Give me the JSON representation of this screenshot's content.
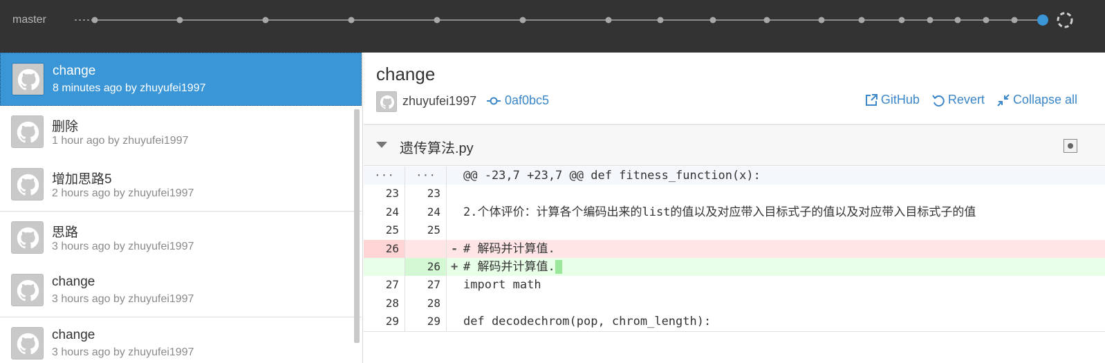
{
  "app": {
    "branch": "master"
  },
  "commits": [
    {
      "title": "change",
      "meta": "8 minutes ago by zhuyufei1997",
      "selected": true
    },
    {
      "title": "删除",
      "meta": "1 hour ago by zhuyufei1997"
    },
    {
      "title": "增加思路5",
      "meta": "2 hours ago by zhuyufei1997"
    },
    {
      "title": "思路",
      "meta": "3 hours ago by zhuyufei1997"
    },
    {
      "title": "change",
      "meta": "3 hours ago by zhuyufei1997"
    },
    {
      "title": "change",
      "meta": "3 hours ago by zhuyufei1997"
    }
  ],
  "detail": {
    "title": "change",
    "author": "zhuyufei1997",
    "sha": "0af0bc5",
    "actions": {
      "github": "GitHub",
      "revert": "Revert",
      "collapse": "Collapse all"
    }
  },
  "file": {
    "name": "遗传算法.py",
    "lines": [
      {
        "type": "hunk",
        "old": "···",
        "new": "···",
        "marker": "",
        "code": "@@ -23,7 +23,7 @@ def fitness_function(x):"
      },
      {
        "type": "ctx",
        "old": "23",
        "new": "23",
        "marker": "",
        "code": ""
      },
      {
        "type": "ctx",
        "old": "24",
        "new": "24",
        "marker": "",
        "code": "2.个体评价：计算各个编码出来的list的值以及对应带入目标式子的值以及对应带入目标式子的值"
      },
      {
        "type": "ctx",
        "old": "25",
        "new": "25",
        "marker": "",
        "code": ""
      },
      {
        "type": "del",
        "old": "26",
        "new": "",
        "marker": "-",
        "code": "# 解码并计算值."
      },
      {
        "type": "add",
        "old": "",
        "new": "26",
        "marker": "+",
        "code": "# 解码并计算值."
      },
      {
        "type": "ctx",
        "old": "27",
        "new": "27",
        "marker": "",
        "code": "import math"
      },
      {
        "type": "ctx",
        "old": "28",
        "new": "28",
        "marker": "",
        "code": ""
      },
      {
        "type": "ctx",
        "old": "29",
        "new": "29",
        "marker": "",
        "code": "def decodechrom(pop, chrom_length):"
      }
    ]
  },
  "colors": {
    "topbar": "#333333",
    "selected": "#3a96d6",
    "link": "#3a86c8",
    "timeline_dot": "#a8a8a8",
    "timeline_active": "#3a96d6"
  }
}
